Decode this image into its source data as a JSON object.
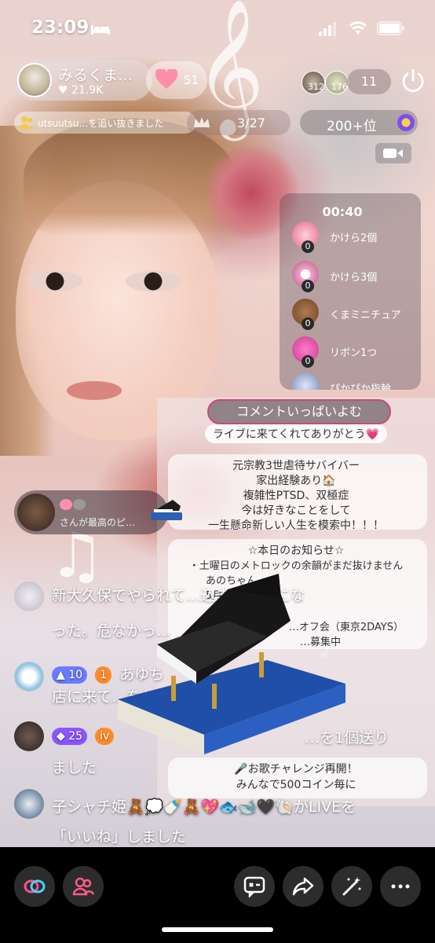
{
  "status_bar": {
    "time": "23:09"
  },
  "host": {
    "name": "みるくま…",
    "likes": "♥ 21.9K",
    "follow_count": "51"
  },
  "viewers": {
    "counts": [
      "312",
      "176"
    ],
    "total": "11"
  },
  "notice": {
    "text": "utsuutsu…を追い抜きました"
  },
  "progress": {
    "text": "3/27"
  },
  "rank": {
    "text": "200+位"
  },
  "gift_panel": {
    "timer": "00:40",
    "items": [
      {
        "name": "かけら2個",
        "count": "0"
      },
      {
        "name": "かけら3個",
        "count": "0"
      },
      {
        "name": "くまミニチュア",
        "count": "0"
      },
      {
        "name": "リボン1つ",
        "count": "0"
      },
      {
        "name": "ぴかぴか指輪",
        "count": ""
      }
    ]
  },
  "board": {
    "title": "コメントいっぱいよむ",
    "greeting": "ライブに来てくれてありがとう💗",
    "profile": [
      "元宗教3世虐待サバイバー",
      "家出経験あり🏠",
      "複雑性PTSD、双極症",
      "今は好きなことをして",
      "一生懸命新しい人生を模索中！！！"
    ],
    "notice_title": "☆本日のお知らせ☆",
    "notice_lines": [
      "・土曜日のメトロックの余韻がまだ抜けません",
      "あのちゃん…",
      "5月…",
      "…オフ会（東京2DAYS）",
      "…募集中"
    ],
    "challenge": [
      "🎤お歌チャレンジ再開！",
      "みんなで500コイン毎に"
    ]
  },
  "chat": {
    "toast_text": "さんが最高のピ…",
    "messages": [
      {
        "line1": "新大久保でやられて…込まれそうにな",
        "line2": "った。危なかっ…"
      },
      {
        "badge1": "10",
        "name": "あゆち",
        "line2": "店に来て…をしろよな"
      },
      {
        "badge1": "25",
        "line1_tail": "…を1個送り",
        "line2": "ました"
      },
      {
        "name": "子シャチ姫🧸💭🍼🧸💖🐟🐋🖤🐚がLIVEを",
        "line2": "「いいね」しました"
      }
    ]
  },
  "colors": {
    "accent_pink": "#c64a7b",
    "badge_blue": "#6a7cff",
    "badge_orange": "#ff8a2a",
    "badge_purple": "#8c55ff"
  }
}
